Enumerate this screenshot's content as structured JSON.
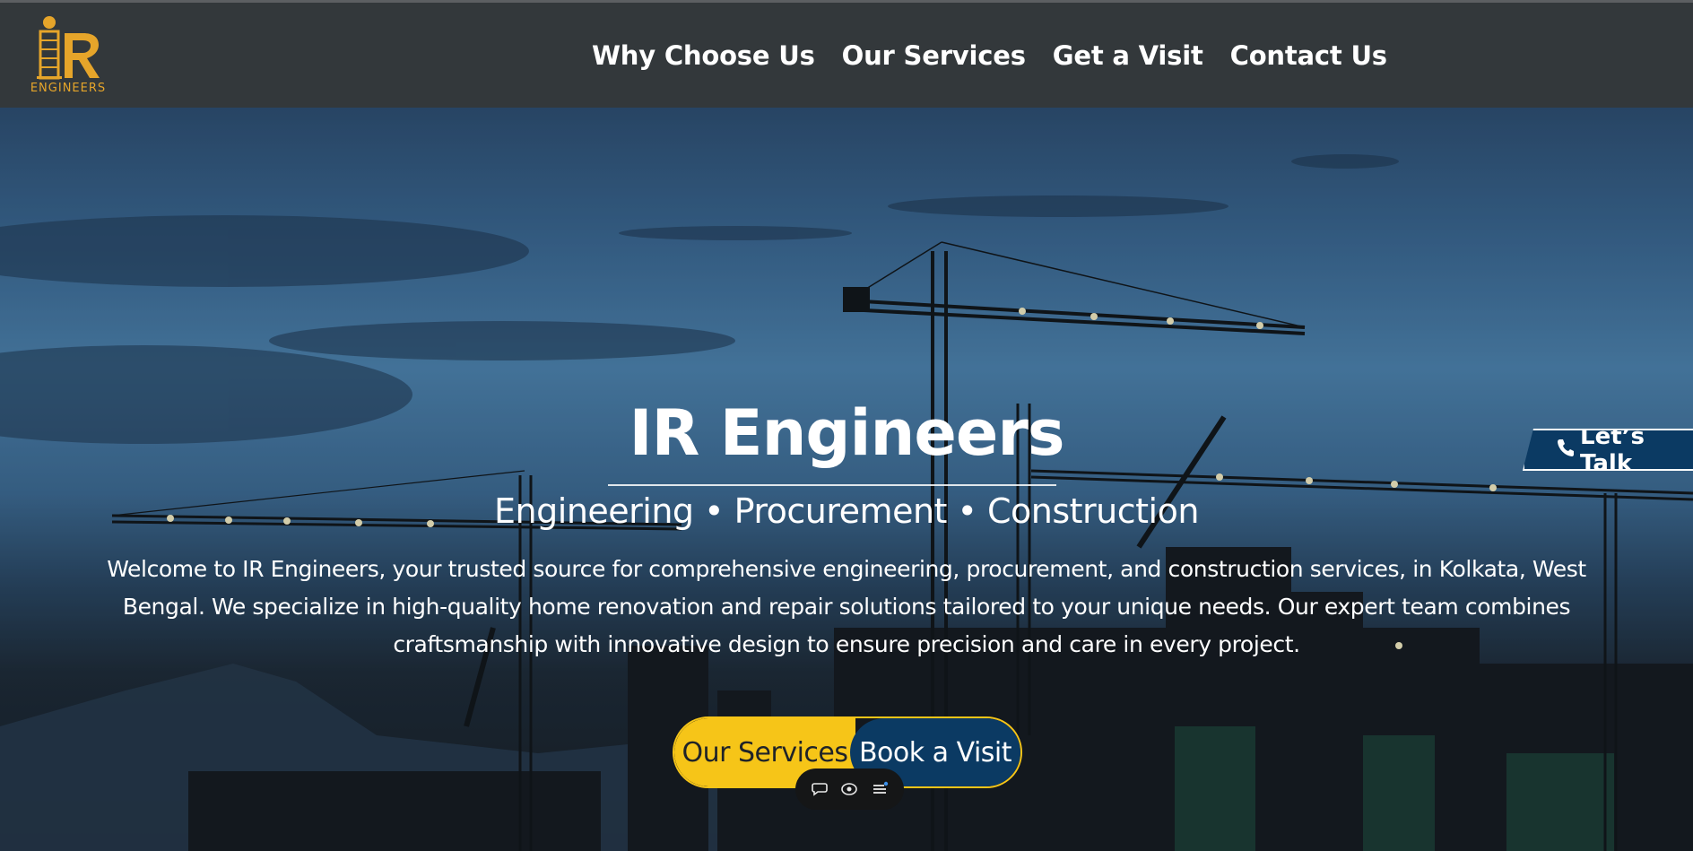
{
  "brand": {
    "logo_text": "ENGINEERS",
    "logo_letters": "IR",
    "accent_color": "#e6a52a"
  },
  "nav": {
    "items": [
      {
        "label": "Why Choose Us"
      },
      {
        "label": "Our Services"
      },
      {
        "label": "Get a Visit"
      },
      {
        "label": "Contact Us"
      }
    ]
  },
  "hero": {
    "title": "IR Engineers",
    "subtitle": "Engineering • Procurement • Construction",
    "description": "Welcome to IR Engineers, your trusted source for comprehensive engineering, procurement, and construction services, in Kolkata, West Bengal. We specialize in high-quality home renovation and repair solutions tailored to your unique needs. Our expert team combines craftsmanship with innovative design to ensure precision and care in every project.",
    "primary_cta": "Our Services",
    "secondary_cta": "Book a Visit"
  },
  "talk_tab": {
    "label": "Let’s Talk",
    "icon": "phone-icon"
  },
  "toolbar": {
    "icons": [
      "chat-icon",
      "view-icon",
      "menu-icon"
    ]
  },
  "colors": {
    "header_bg": "#33383b",
    "cta_yellow": "#f6c518",
    "cta_blue": "#0b3a63"
  }
}
